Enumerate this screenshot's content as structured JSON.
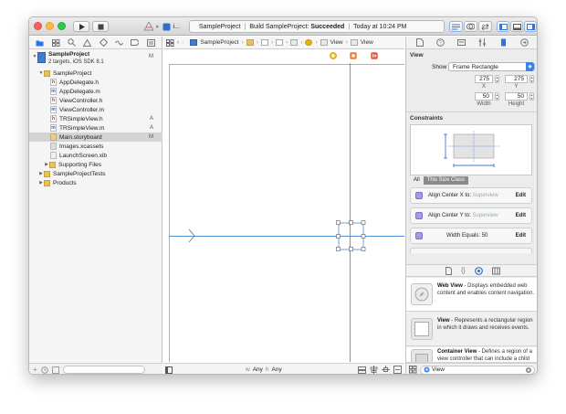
{
  "toolbar": {
    "scheme_label": "i...",
    "activity": {
      "project": "SampleProject",
      "status_prefix": "Build SampleProject:",
      "status_value": "Succeeded",
      "time": "Today at 10:24 PM"
    }
  },
  "navigator": {
    "project": {
      "name": "SampleProject",
      "subtitle": "2 targets, iOS SDK 8.1",
      "badge": "M"
    },
    "items": [
      {
        "label": "SampleProject",
        "type": "folder",
        "badge": ""
      },
      {
        "label": "AppDelegate.h",
        "type": "h",
        "badge": ""
      },
      {
        "label": "AppDelegate.m",
        "type": "m",
        "badge": ""
      },
      {
        "label": "ViewController.h",
        "type": "h",
        "badge": ""
      },
      {
        "label": "ViewController.m",
        "type": "m",
        "badge": ""
      },
      {
        "label": "TRSimpleView.h",
        "type": "h",
        "badge": "A"
      },
      {
        "label": "TRSimpleView.m",
        "type": "m",
        "badge": "A"
      },
      {
        "label": "Main.storyboard",
        "type": "storyboard",
        "badge": "M"
      },
      {
        "label": "Images.xcassets",
        "type": "assets",
        "badge": ""
      },
      {
        "label": "LaunchScreen.xib",
        "type": "xib",
        "badge": ""
      },
      {
        "label": "Supporting Files",
        "type": "folder",
        "badge": ""
      },
      {
        "label": "SampleProjectTests",
        "type": "folder",
        "badge": ""
      },
      {
        "label": "Products",
        "type": "folder",
        "badge": ""
      }
    ],
    "file_type_letters": {
      "h": "h",
      "m": "m"
    }
  },
  "editor": {
    "jumpbar": {
      "project": "SampleProject",
      "crumb_view1": "View",
      "crumb_view2": "View"
    },
    "size_class": {
      "width": "Any",
      "height": "Any"
    }
  },
  "inspector": {
    "view_section": {
      "title": "View",
      "show_label": "Show",
      "show_value": "Frame Rectangle"
    },
    "frame": {
      "x": "275",
      "y": "275",
      "width": "50",
      "height": "50",
      "x_label": "X",
      "y_label": "Y",
      "width_label": "Width",
      "height_label": "Height"
    },
    "constraints": {
      "title": "Constraints",
      "tab_all": "All",
      "tab_size_class": "This Size Class",
      "rows": [
        {
          "label": "Align Center X to:",
          "target": "Superview",
          "action": "Edit"
        },
        {
          "label": "Align Center Y to:",
          "target": "Superview",
          "action": "Edit"
        },
        {
          "label": "Width Equals:",
          "target": "50",
          "action": "Edit"
        }
      ]
    },
    "library": [
      {
        "title": "Web View",
        "desc": " - Displays embedded web content and enables content navigation."
      },
      {
        "title": "View",
        "desc": " - Represents a rectangular region in which it draws and receives events."
      },
      {
        "title": "Container View",
        "desc": " - Defines a region of a view controller that can include a child view controller."
      }
    ],
    "search": {
      "value": "View"
    }
  },
  "colors": {
    "accent": "#2a75df",
    "guide_line": "#4f8fd6",
    "success_text": "#000000",
    "constraint_icon": "#a99be3"
  }
}
